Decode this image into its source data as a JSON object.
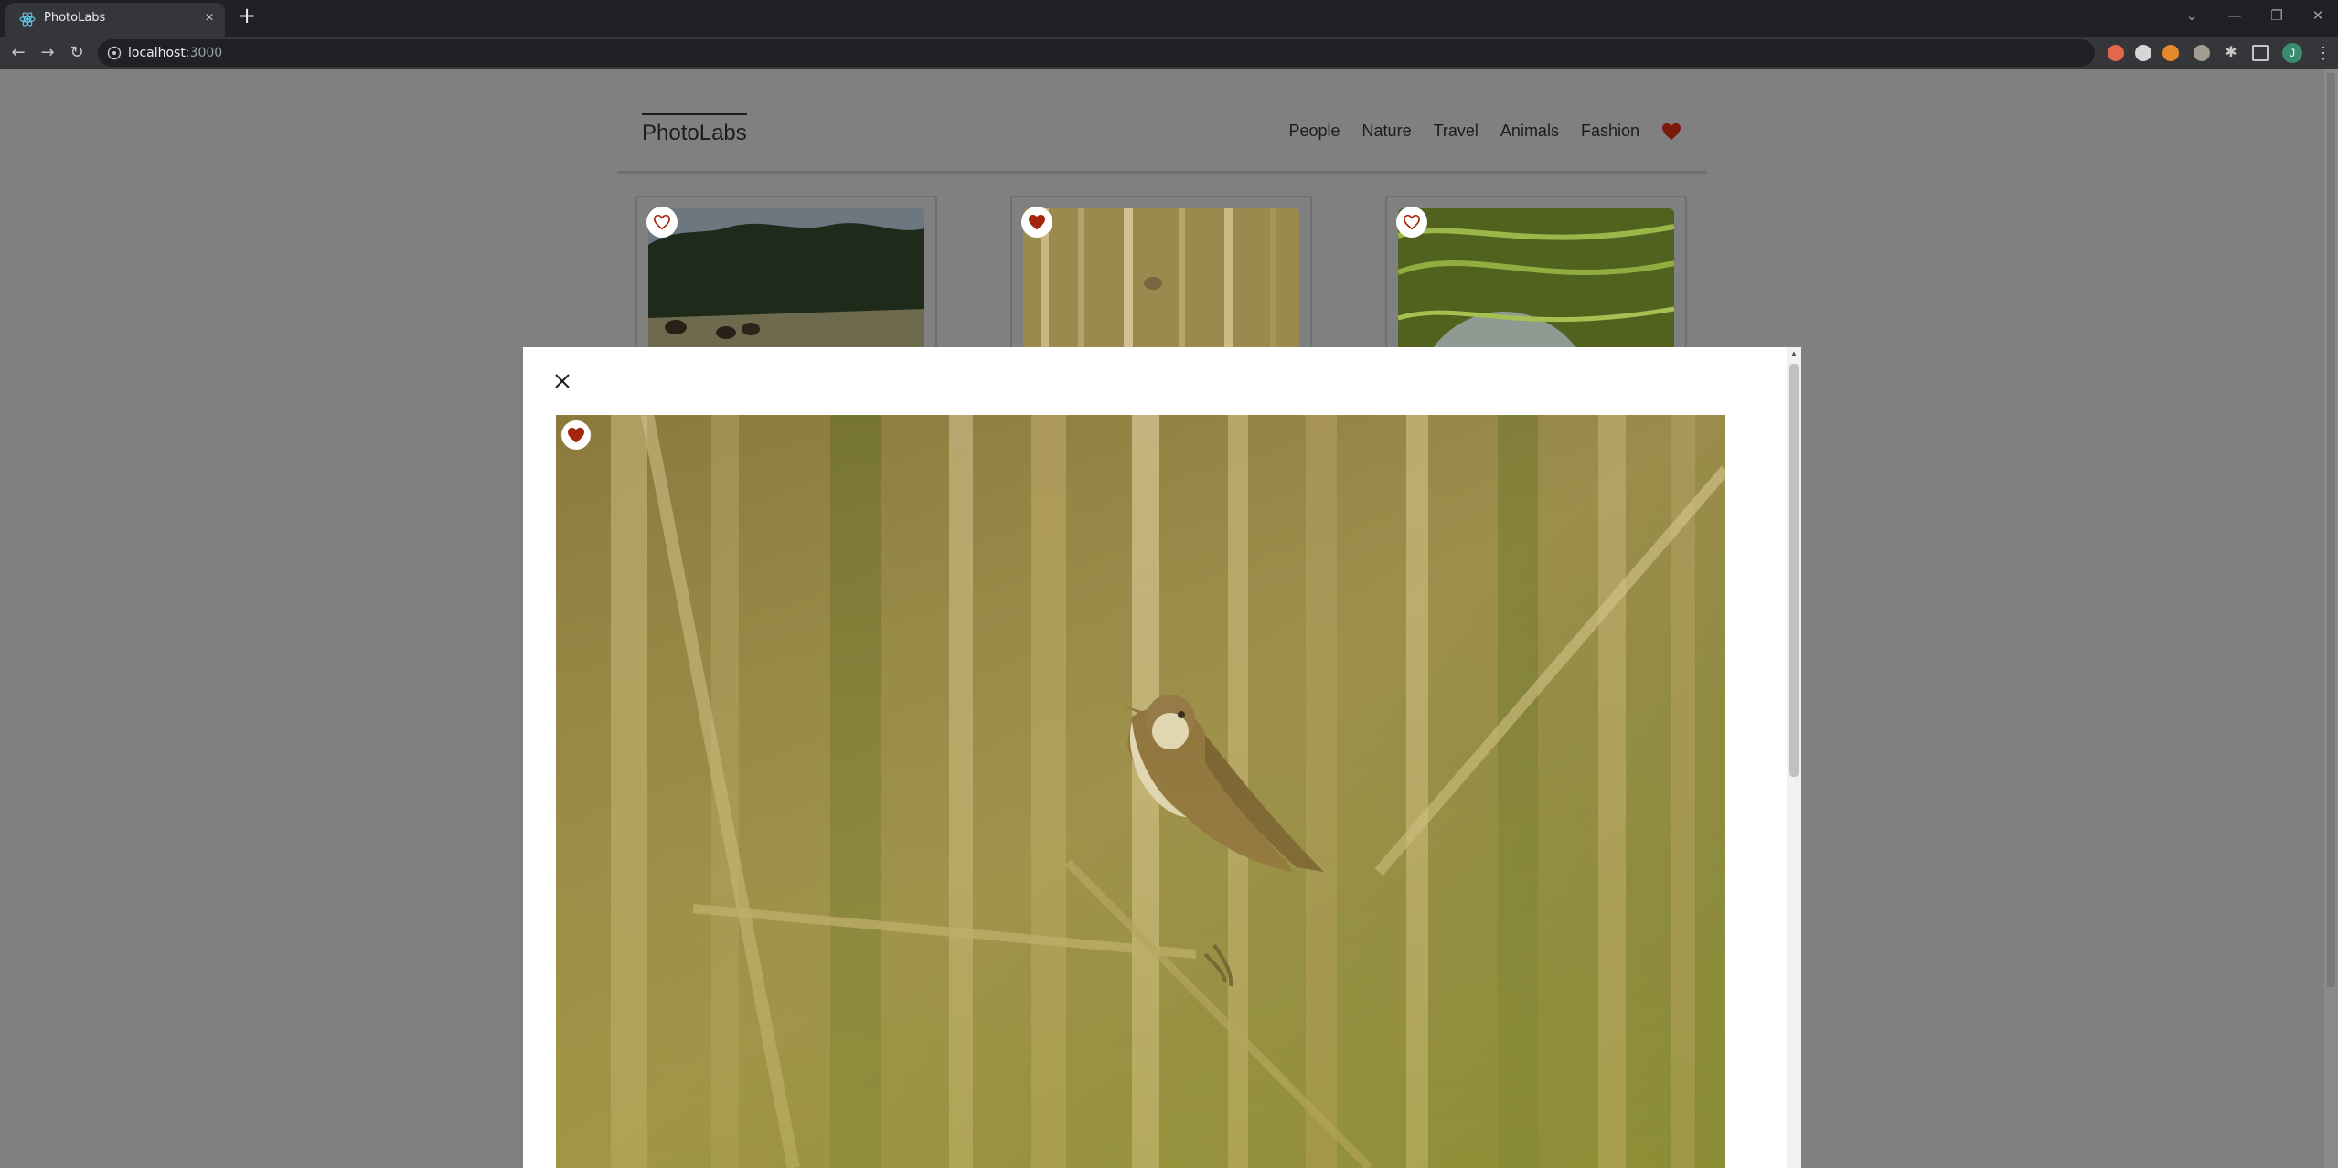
{
  "browser": {
    "tab_title": "PhotoLabs",
    "tab_close_glyph": "×",
    "new_tab_glyph": "+",
    "url_host": "localhost",
    "url_port": ":3000",
    "profile_initial": "J",
    "back_glyph": "←",
    "forward_glyph": "→",
    "reload_glyph": "↻",
    "menu_glyph": "⋮"
  },
  "app": {
    "logo": "PhotoLabs",
    "topics": [
      "People",
      "Nature",
      "Travel",
      "Animals",
      "Fashion"
    ],
    "fav_notification_color": "#a5260f"
  },
  "grid": {
    "photos": [
      {
        "subject": "grazing animals in forest meadow",
        "favourited": false
      },
      {
        "subject": "bird among reeds",
        "favourited": true
      },
      {
        "subject": "terraced rice fields",
        "favourited": false
      }
    ]
  },
  "modal": {
    "photo_subject": "reed warbler perched among reeds",
    "favourited": true
  },
  "colors": {
    "overlay": "#808080",
    "heart": "#a5260f",
    "modal_bg": "#ffffff"
  }
}
